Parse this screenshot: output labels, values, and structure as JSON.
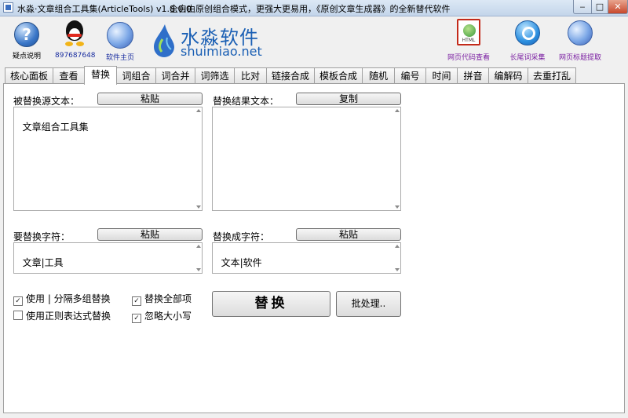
{
  "window": {
    "title": "水淼·文章组合工具集(ArticleTools) v1.8.0.0",
    "slogan": "全自由原创组合模式，更强大更易用，《原创文章生成器》的全新替代软件",
    "min": "‒",
    "max": "□",
    "close": "✕"
  },
  "toolbar": {
    "help_label": "疑点说明",
    "help_glyph": "?",
    "qq_label": "897687648",
    "home_label": "软件主页",
    "brand_text": "水淼软件",
    "brand_url": "shuimiao.net",
    "html_label": "网页代码查看",
    "html_badge": "HTML",
    "longtail_label": "长尾词采集",
    "title_label": "网页标题提取",
    "accent": "#7b1fa2"
  },
  "tabs": [
    "核心面板",
    "查看",
    "替换",
    "词组合",
    "词合并",
    "词筛选",
    "比对",
    "链接合成",
    "模板合成",
    "随机",
    "编号",
    "时间",
    "拼音",
    "编解码",
    "去重打乱"
  ],
  "active_tab": 2,
  "form": {
    "source_label": "被替换源文本：",
    "source_paste": "粘贴",
    "source_text": "文章组合工具集",
    "result_label": "替换结果文本：",
    "result_copy": "复制",
    "result_text": "",
    "find_label": "要替换字符：",
    "find_paste": "粘贴",
    "find_text": "文章|工具",
    "replace_label": "替换成字符：",
    "replace_paste": "粘贴",
    "replace_text": "文本|软件",
    "opt_pipe": "使用 | 分隔多组替换",
    "opt_pipe_checked": true,
    "opt_regex": "使用正则表达式替换",
    "opt_regex_checked": false,
    "opt_all": "替换全部项",
    "opt_all_checked": true,
    "opt_case": "忽略大小写",
    "opt_case_checked": true,
    "replace_btn": "替换",
    "batch_btn": "批处理.."
  }
}
